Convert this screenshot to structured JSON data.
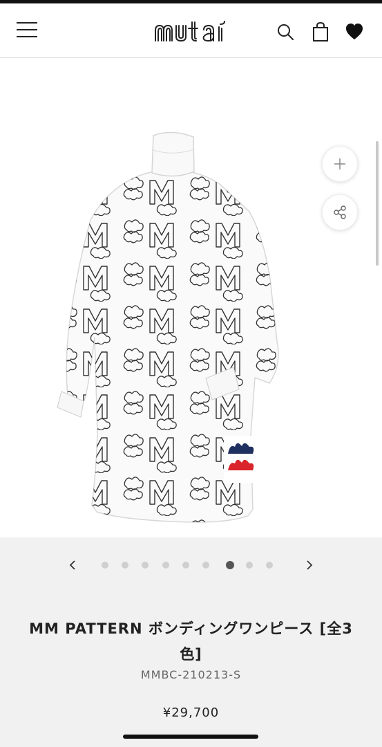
{
  "header": {
    "logo_text": "muta",
    "icons": [
      "hamburger-menu-icon",
      "search-icon",
      "shopping-bag-icon",
      "heart-icon"
    ]
  },
  "gallery": {
    "total_images": 9,
    "active_index": 6,
    "zoom_icon": "plus-icon",
    "share_icon": "share-icon"
  },
  "product": {
    "title": "MM PATTERN ボンディングワンピース [全3色]",
    "sku": "MMBC-210213-S",
    "price": "¥29,700"
  },
  "colors": {
    "text": "#222222",
    "info_background": "#f1f1f1",
    "dot_inactive": "#cfcfcf",
    "dot_active": "#555555",
    "patch_blue": "#1f2f5f",
    "patch_red": "#d9252b"
  }
}
